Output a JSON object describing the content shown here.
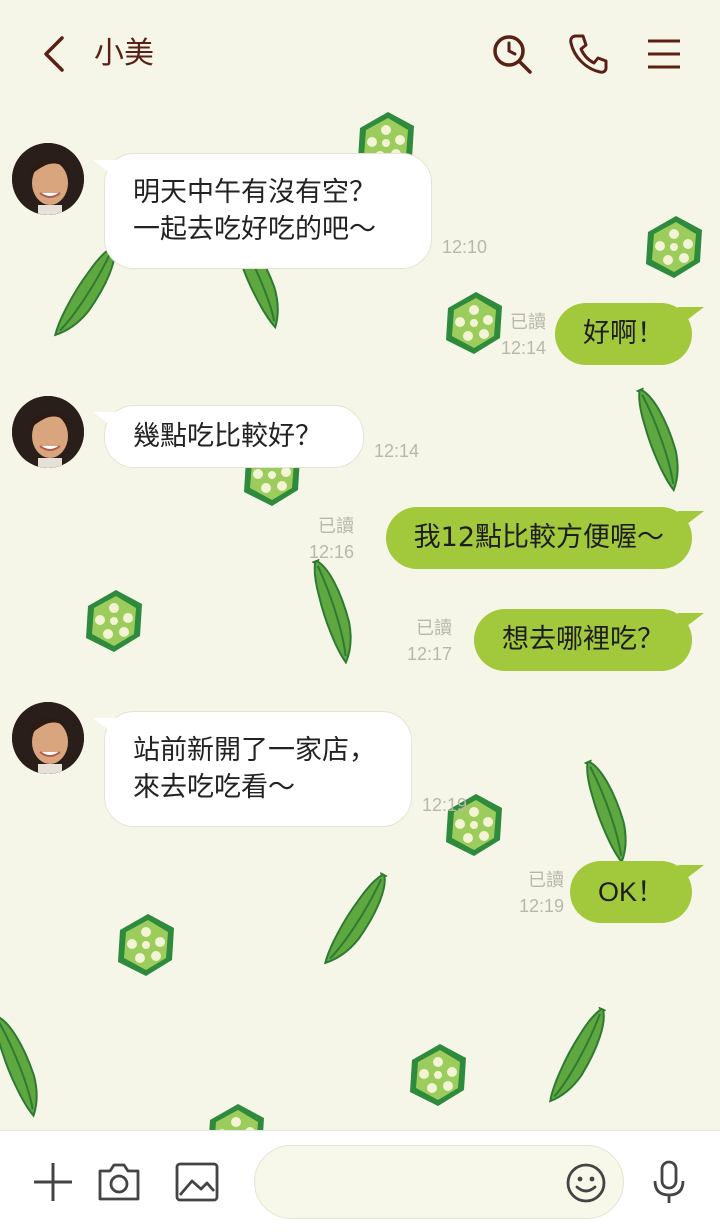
{
  "header": {
    "contact_name": "小美",
    "icons": [
      "back-icon",
      "search-icon",
      "phone-icon",
      "menu-icon"
    ]
  },
  "messages": [
    {
      "side": "in",
      "text": "明天中午有沒有空？\n一起去吃好吃的吧〜",
      "time": "12:10"
    },
    {
      "side": "out",
      "text": "好啊！",
      "read": "已讀",
      "time": "12:14"
    },
    {
      "side": "in",
      "text": "幾點吃比較好？",
      "time": "12:14"
    },
    {
      "side": "out",
      "text": "我12點比較方便喔〜",
      "read": "已讀",
      "time": "12:16"
    },
    {
      "side": "out",
      "text": "想去哪裡吃？",
      "read": "已讀",
      "time": "12:17"
    },
    {
      "side": "in",
      "text": "站前新開了一家店，\n來去吃吃看〜",
      "time": "12:19"
    },
    {
      "side": "out",
      "text": "OK！",
      "read": "已讀",
      "time": "12:19"
    }
  ],
  "footer": {
    "input_placeholder": "",
    "input_value": "",
    "icons": [
      "plus-icon",
      "camera-icon",
      "image-icon",
      "emoji-icon",
      "microphone-icon"
    ]
  },
  "colors": {
    "background": "#f5f5e8",
    "outgoing_bubble": "#a2c83c",
    "incoming_bubble": "#ffffff",
    "header_text": "#5a2015",
    "okra_green": "#6aaa3a"
  }
}
